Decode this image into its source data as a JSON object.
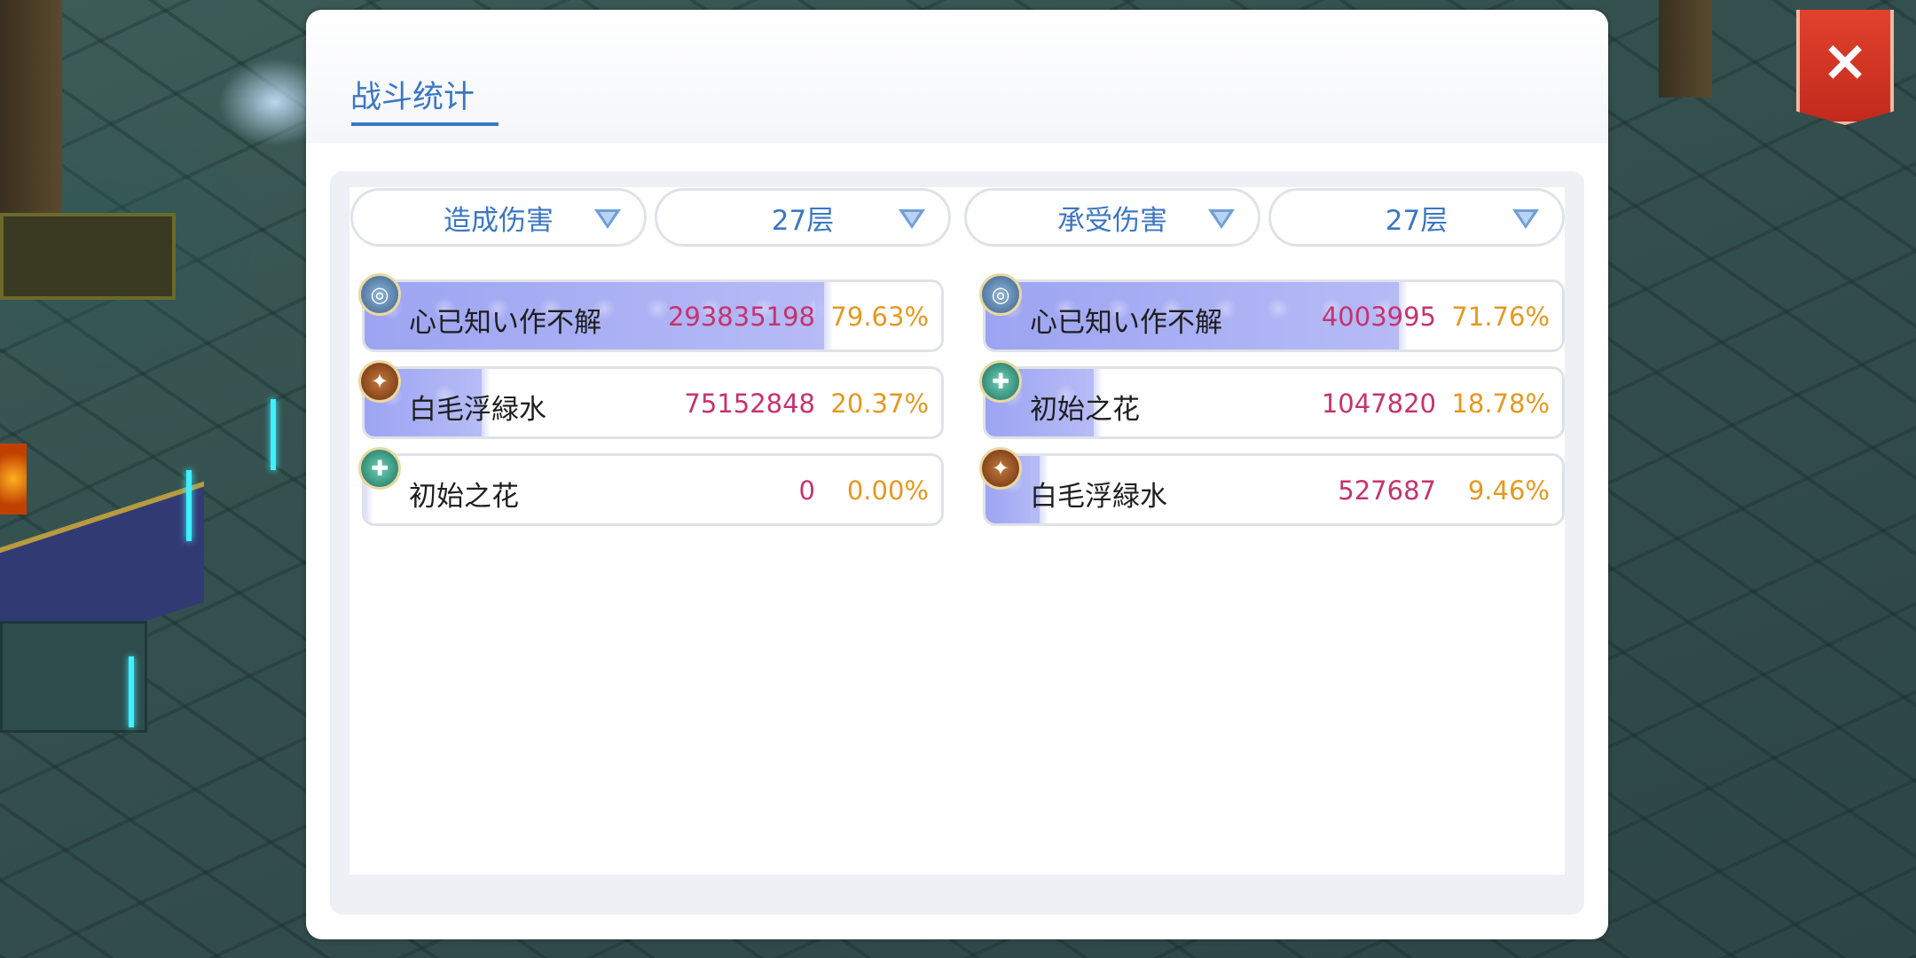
{
  "window": {
    "tab_label": "战斗统计",
    "close_icon": "×"
  },
  "filters": {
    "left_type": "造成伤害",
    "left_floor": "27层",
    "right_type": "承受伤害",
    "right_floor": "27层"
  },
  "dealt": [
    {
      "name": "心已知い作不解",
      "value": "293835198",
      "percent": "79.63%",
      "share": 0.7963,
      "icon": "blue-emblem-icon"
    },
    {
      "name": "白毛浮緑水",
      "value": "75152848",
      "percent": "20.37%",
      "share": 0.2037,
      "icon": "brown-emblem-icon"
    },
    {
      "name": "初始之花",
      "value": "0",
      "percent": "0.00%",
      "share": 0.0,
      "icon": "teal-emblem-icon"
    }
  ],
  "taken": [
    {
      "name": "心已知い作不解",
      "value": "4003995",
      "percent": "71.76%",
      "share": 0.7176,
      "icon": "blue-emblem-icon"
    },
    {
      "name": "初始之花",
      "value": "1047820",
      "percent": "18.78%",
      "share": 0.1878,
      "icon": "teal-emblem-icon"
    },
    {
      "name": "白毛浮緑水",
      "value": "527687",
      "percent": "9.46%",
      "share": 0.0946,
      "icon": "brown-emblem-icon"
    }
  ],
  "colors": {
    "accent": "#3b76c4",
    "value": "#c5336e",
    "percent": "#e4991f",
    "bar": "#9da4f2",
    "close": "#d9382a"
  }
}
